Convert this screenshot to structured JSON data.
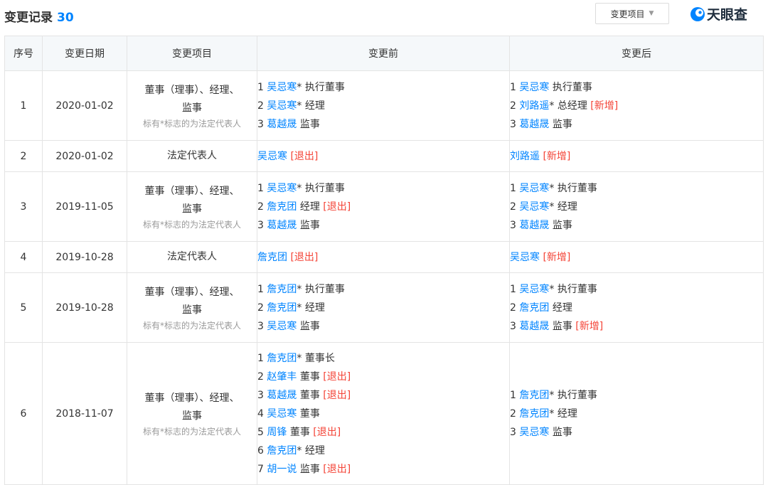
{
  "header": {
    "title": "变更记录",
    "count": "30",
    "filter_label": "变更项目",
    "logo_text": "天眼查"
  },
  "colors": {
    "link": "#0084ff",
    "tag": "#f44336",
    "note": "#999999",
    "header_bg": "#f5f8fa"
  },
  "columns": [
    "序号",
    "变更日期",
    "变更项目",
    "变更前",
    "变更后"
  ],
  "rows": [
    {
      "index": "1",
      "date": "2020-01-02",
      "item": "董事（理事）、经理、监事",
      "item_note": "标有*标志的为法定代表人",
      "before": [
        {
          "num": "1",
          "name": "吴忌寒",
          "mark": "*",
          "role": "执行董事",
          "tag": ""
        },
        {
          "num": "2",
          "name": "吴忌寒",
          "mark": "*",
          "role": "经理",
          "tag": ""
        },
        {
          "num": "3",
          "name": "葛越晟",
          "mark": "",
          "role": "监事",
          "tag": ""
        }
      ],
      "after": [
        {
          "num": "1",
          "name": "吴忌寒",
          "mark": "",
          "role": "执行董事",
          "tag": ""
        },
        {
          "num": "2",
          "name": "刘路遥",
          "mark": "*",
          "role": "总经理",
          "tag": "[新增]"
        },
        {
          "num": "3",
          "name": "葛越晟",
          "mark": "",
          "role": "监事",
          "tag": ""
        }
      ]
    },
    {
      "index": "2",
      "date": "2020-01-02",
      "item": "法定代表人",
      "item_note": "",
      "before": [
        {
          "num": "",
          "name": "吴忌寒",
          "mark": "",
          "role": "",
          "tag": "[退出]"
        }
      ],
      "after": [
        {
          "num": "",
          "name": "刘路遥",
          "mark": "",
          "role": "",
          "tag": "[新增]"
        }
      ]
    },
    {
      "index": "3",
      "date": "2019-11-05",
      "item": "董事（理事）、经理、监事",
      "item_note": "标有*标志的为法定代表人",
      "before": [
        {
          "num": "1",
          "name": "吴忌寒",
          "mark": "*",
          "role": "执行董事",
          "tag": ""
        },
        {
          "num": "2",
          "name": "詹克团",
          "mark": "",
          "role": "经理",
          "tag": "[退出]"
        },
        {
          "num": "3",
          "name": "葛越晟",
          "mark": "",
          "role": "监事",
          "tag": ""
        }
      ],
      "after": [
        {
          "num": "1",
          "name": "吴忌寒",
          "mark": "*",
          "role": "执行董事",
          "tag": ""
        },
        {
          "num": "2",
          "name": "吴忌寒",
          "mark": "*",
          "role": "经理",
          "tag": ""
        },
        {
          "num": "3",
          "name": "葛越晟",
          "mark": "",
          "role": "监事",
          "tag": ""
        }
      ]
    },
    {
      "index": "4",
      "date": "2019-10-28",
      "item": "法定代表人",
      "item_note": "",
      "before": [
        {
          "num": "",
          "name": "詹克团",
          "mark": "",
          "role": "",
          "tag": "[退出]"
        }
      ],
      "after": [
        {
          "num": "",
          "name": "吴忌寒",
          "mark": "",
          "role": "",
          "tag": "[新增]"
        }
      ]
    },
    {
      "index": "5",
      "date": "2019-10-28",
      "item": "董事（理事）、经理、监事",
      "item_note": "标有*标志的为法定代表人",
      "before": [
        {
          "num": "1",
          "name": "詹克团",
          "mark": "*",
          "role": "执行董事",
          "tag": ""
        },
        {
          "num": "2",
          "name": "詹克团",
          "mark": "*",
          "role": "经理",
          "tag": ""
        },
        {
          "num": "3",
          "name": "吴忌寒",
          "mark": "",
          "role": "监事",
          "tag": ""
        }
      ],
      "after": [
        {
          "num": "1",
          "name": "吴忌寒",
          "mark": "*",
          "role": "执行董事",
          "tag": ""
        },
        {
          "num": "2",
          "name": "詹克团",
          "mark": "",
          "role": "经理",
          "tag": ""
        },
        {
          "num": "3",
          "name": "葛越晟",
          "mark": "",
          "role": "监事",
          "tag": "[新增]"
        }
      ]
    },
    {
      "index": "6",
      "date": "2018-11-07",
      "item": "董事（理事）、经理、监事",
      "item_note": "标有*标志的为法定代表人",
      "before": [
        {
          "num": "1",
          "name": "詹克团",
          "mark": "*",
          "role": "董事长",
          "tag": ""
        },
        {
          "num": "2",
          "name": "赵肇丰",
          "mark": "",
          "role": "董事",
          "tag": "[退出]"
        },
        {
          "num": "3",
          "name": "葛越晟",
          "mark": "",
          "role": "董事",
          "tag": "[退出]"
        },
        {
          "num": "4",
          "name": "吴忌寒",
          "mark": "",
          "role": "董事",
          "tag": ""
        },
        {
          "num": "5",
          "name": "周锋",
          "mark": "",
          "role": "董事",
          "tag": "[退出]"
        },
        {
          "num": "6",
          "name": "詹克团",
          "mark": "*",
          "role": "经理",
          "tag": ""
        },
        {
          "num": "7",
          "name": "胡一说",
          "mark": "",
          "role": "监事",
          "tag": "[退出]"
        }
      ],
      "after": [
        {
          "num": "1",
          "name": "詹克团",
          "mark": "*",
          "role": "执行董事",
          "tag": ""
        },
        {
          "num": "2",
          "name": "詹克团",
          "mark": "*",
          "role": "经理",
          "tag": ""
        },
        {
          "num": "3",
          "name": "吴忌寒",
          "mark": "",
          "role": "监事",
          "tag": ""
        }
      ]
    }
  ]
}
